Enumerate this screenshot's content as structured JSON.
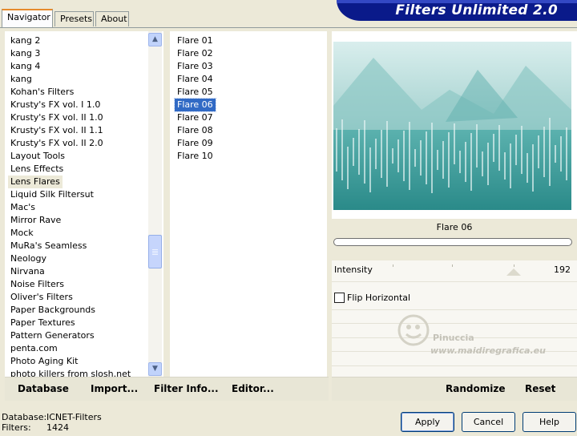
{
  "tabs": [
    {
      "label": "Navigator",
      "active": true
    },
    {
      "label": "Presets",
      "active": false
    },
    {
      "label": "About",
      "active": false
    }
  ],
  "banner": {
    "title": "Filters Unlimited 2.0"
  },
  "categories": {
    "items": [
      "kang 2",
      "kang 3",
      "kang 4",
      "kang",
      "Kohan's Filters",
      "Krusty's FX vol. I 1.0",
      "Krusty's FX vol. II 1.0",
      "Krusty's FX vol. II 1.1",
      "Krusty's FX vol. II 2.0",
      "Layout Tools",
      "Lens Effects",
      "Lens Flares",
      "Liquid Silk Filtersut",
      "Mac's",
      "Mirror Rave",
      "Mock",
      "MuRa's Seamless",
      "Neology",
      "Nirvana",
      "Noise Filters",
      "Oliver's Filters",
      "Paper Backgrounds",
      "Paper Textures",
      "Pattern Generators",
      "penta.com",
      "Photo Aging Kit",
      "photo killers from slosh.net"
    ],
    "selected": "Lens Flares"
  },
  "filters": {
    "items": [
      "Flare 01",
      "Flare 02",
      "Flare 03",
      "Flare 04",
      "Flare 05",
      "Flare 06",
      "Flare 07",
      "Flare 08",
      "Flare 09",
      "Flare 10"
    ],
    "selected": "Flare 06"
  },
  "preview": {
    "filter_name": "Flare 06",
    "colors": {
      "teal": "#2e9191",
      "light": "#cfe8e6"
    }
  },
  "controls": {
    "intensity_label": "Intensity",
    "intensity_value": "192",
    "flip_label": "Flip Horizontal",
    "flip_checked": false
  },
  "watermark": {
    "line1": "Pinuccia",
    "line2": "www.maidiregrafica.eu"
  },
  "toolbar_left": {
    "database": "Database",
    "import": "Import...",
    "filter_info": "Filter Info...",
    "editor": "Editor..."
  },
  "toolbar_right": {
    "randomize": "Randomize",
    "reset": "Reset"
  },
  "status": {
    "database_label": "Database:",
    "database_value": "ICNET-Filters",
    "filters_label": "Filters:",
    "filters_value": "1424"
  },
  "buttons": {
    "apply": "Apply",
    "cancel": "Cancel",
    "help": "Help"
  }
}
